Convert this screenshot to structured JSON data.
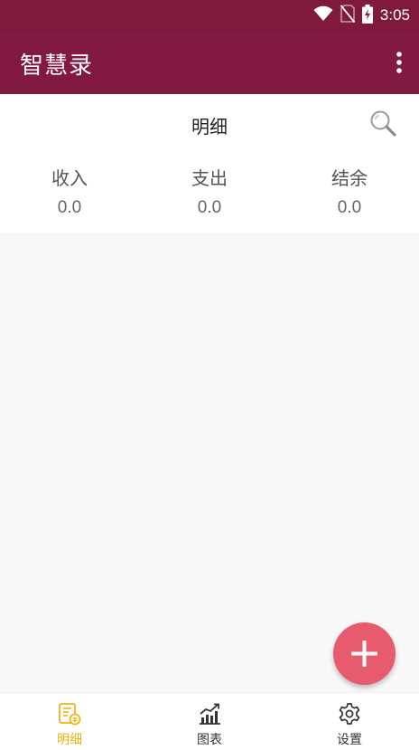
{
  "status_bar": {
    "time": "3:05",
    "icons": [
      "wifi-icon",
      "no-sim-icon",
      "battery-charging-icon"
    ]
  },
  "app_bar": {
    "title": "智慧录",
    "menu_icon": "more-vertical-icon"
  },
  "summary": {
    "title": "明细",
    "search_icon": "search-icon",
    "stats": [
      {
        "label": "收入",
        "value": "0.0"
      },
      {
        "label": "支出",
        "value": "0.0"
      },
      {
        "label": "结余",
        "value": "0.0"
      }
    ]
  },
  "fab": {
    "icon": "plus-icon",
    "color": "#e85a6e"
  },
  "bottom_nav": {
    "items": [
      {
        "label": "明细",
        "icon": "bill-detail-icon",
        "active": true
      },
      {
        "label": "图表",
        "icon": "chart-icon",
        "active": false
      },
      {
        "label": "设置",
        "icon": "gear-icon",
        "active": false
      }
    ]
  },
  "colors": {
    "primary": "#821a40",
    "accent": "#f0b414",
    "fab": "#e85a6e"
  }
}
